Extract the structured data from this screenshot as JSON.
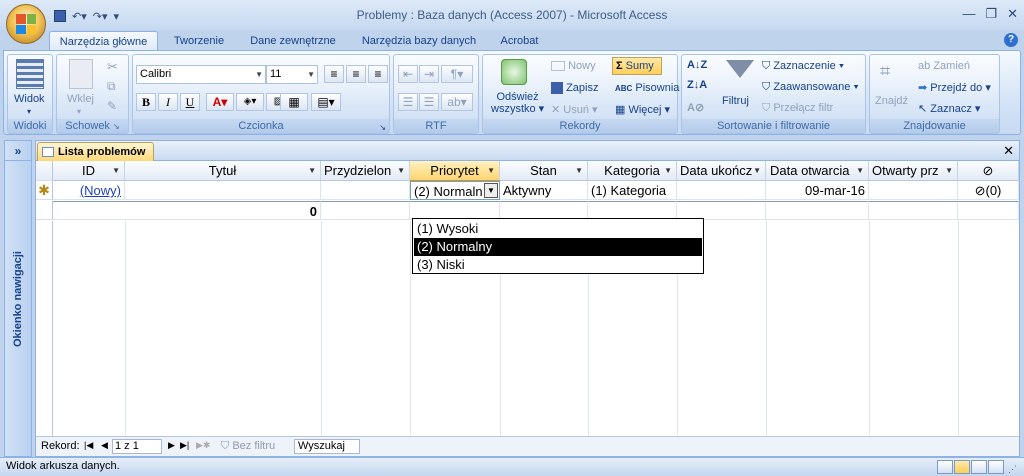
{
  "window": {
    "title": "Problemy : Baza danych (Access 2007) - Microsoft Access"
  },
  "tabs": [
    "Narzędzia główne",
    "Tworzenie",
    "Dane zewnętrzne",
    "Narzędzia bazy danych",
    "Acrobat"
  ],
  "ribbon": {
    "widoki": {
      "label": "Widoki",
      "view": "Widok"
    },
    "schowek": {
      "label": "Schowek",
      "paste": "Wklej"
    },
    "czcionka": {
      "label": "Czcionka",
      "font": "Calibri",
      "size": "11"
    },
    "rtf": {
      "label": "RTF"
    },
    "rekordy": {
      "label": "Rekordy",
      "refresh": "Odśwież wszystko",
      "refresh_l1": "Odśwież",
      "refresh_l2": "wszystko",
      "new": "Nowy",
      "save": "Zapisz",
      "delete": "Usuń",
      "sums": "Sumy",
      "spelling": "Pisownia",
      "more": "Więcej"
    },
    "sort": {
      "label": "Sortowanie i filtrowanie",
      "filter": "Filtruj",
      "selection": "Zaznaczenie",
      "advanced": "Zaawansowane",
      "toggle": "Przełącz filtr"
    },
    "find": {
      "label": "Znajdowanie",
      "find": "Znajdź",
      "replace": "Zamień",
      "goto": "Przejdź do",
      "select": "Zaznacz"
    }
  },
  "nav_pane": {
    "label": "Okienko nawigacji",
    "toggle": "»"
  },
  "document": {
    "tab": "Lista problemów"
  },
  "grid": {
    "columns": [
      "ID",
      "Tytuł",
      "Przydzielon",
      "Priorytet",
      "Stan",
      "Kategoria",
      "Data ukończ",
      "Data otwarcia",
      "Otwarty prz"
    ],
    "new_row": {
      "id": "(Nowy)",
      "priority": "(2) Normaln",
      "status": "Aktywny",
      "category": "(1) Kategoria",
      "opened": "09-mar-16",
      "attachments": "(0)"
    },
    "totals_row": {
      "id": "0"
    }
  },
  "priority_dropdown": {
    "options": [
      "(1) Wysoki",
      "(2) Normalny",
      "(3) Niski"
    ],
    "selected": "(2) Normalny"
  },
  "record_nav": {
    "label": "Rekord:",
    "position": "1 z 1",
    "filter": "Bez filtru",
    "search": "Wyszukaj"
  },
  "status": {
    "text": "Widok arkusza danych."
  }
}
